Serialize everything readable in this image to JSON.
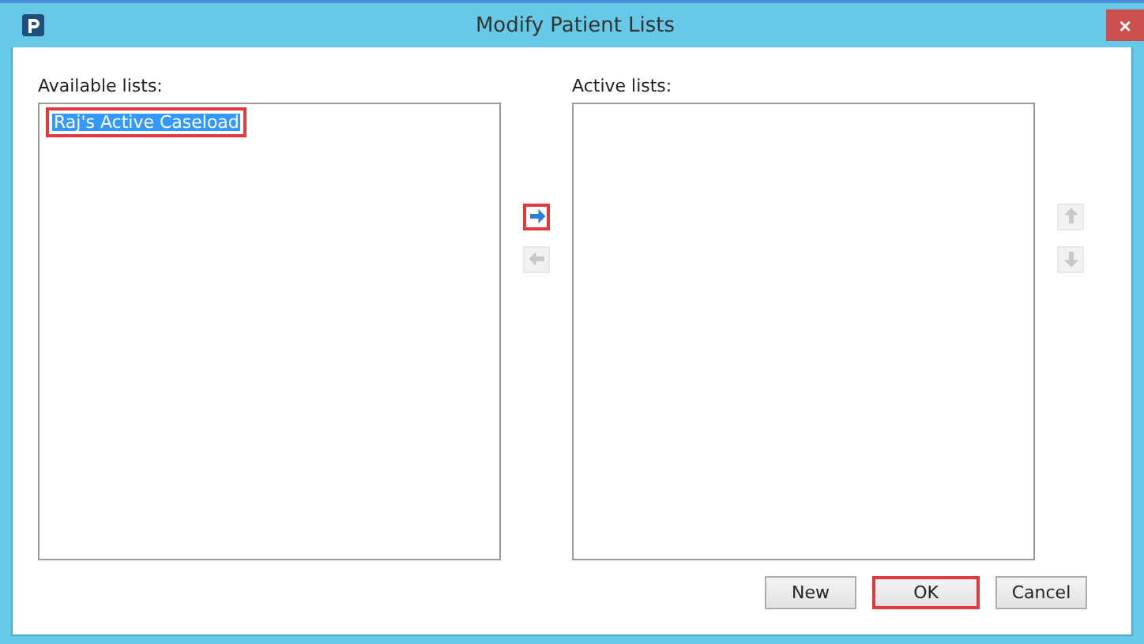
{
  "window": {
    "title": "Modify Patient Lists",
    "close": "×"
  },
  "available": {
    "label": "Available lists:",
    "items": [
      {
        "name": "Raj's Active Caseload",
        "selected": true,
        "highlighted": true
      }
    ]
  },
  "move_buttons": [
    {
      "kind": "right",
      "disabled": false,
      "highlighted": true
    },
    {
      "kind": "left",
      "disabled": true,
      "highlighted": false
    }
  ],
  "active": {
    "label": "Active lists:"
  },
  "order_buttons": [
    {
      "kind": "up",
      "disabled": true
    },
    {
      "kind": "down",
      "disabled": true
    }
  ],
  "buttons": [
    {
      "label": "New",
      "highlighted": false
    },
    {
      "label": "OK",
      "highlighted": true
    },
    {
      "label": "Cancel",
      "highlighted": false
    }
  ]
}
